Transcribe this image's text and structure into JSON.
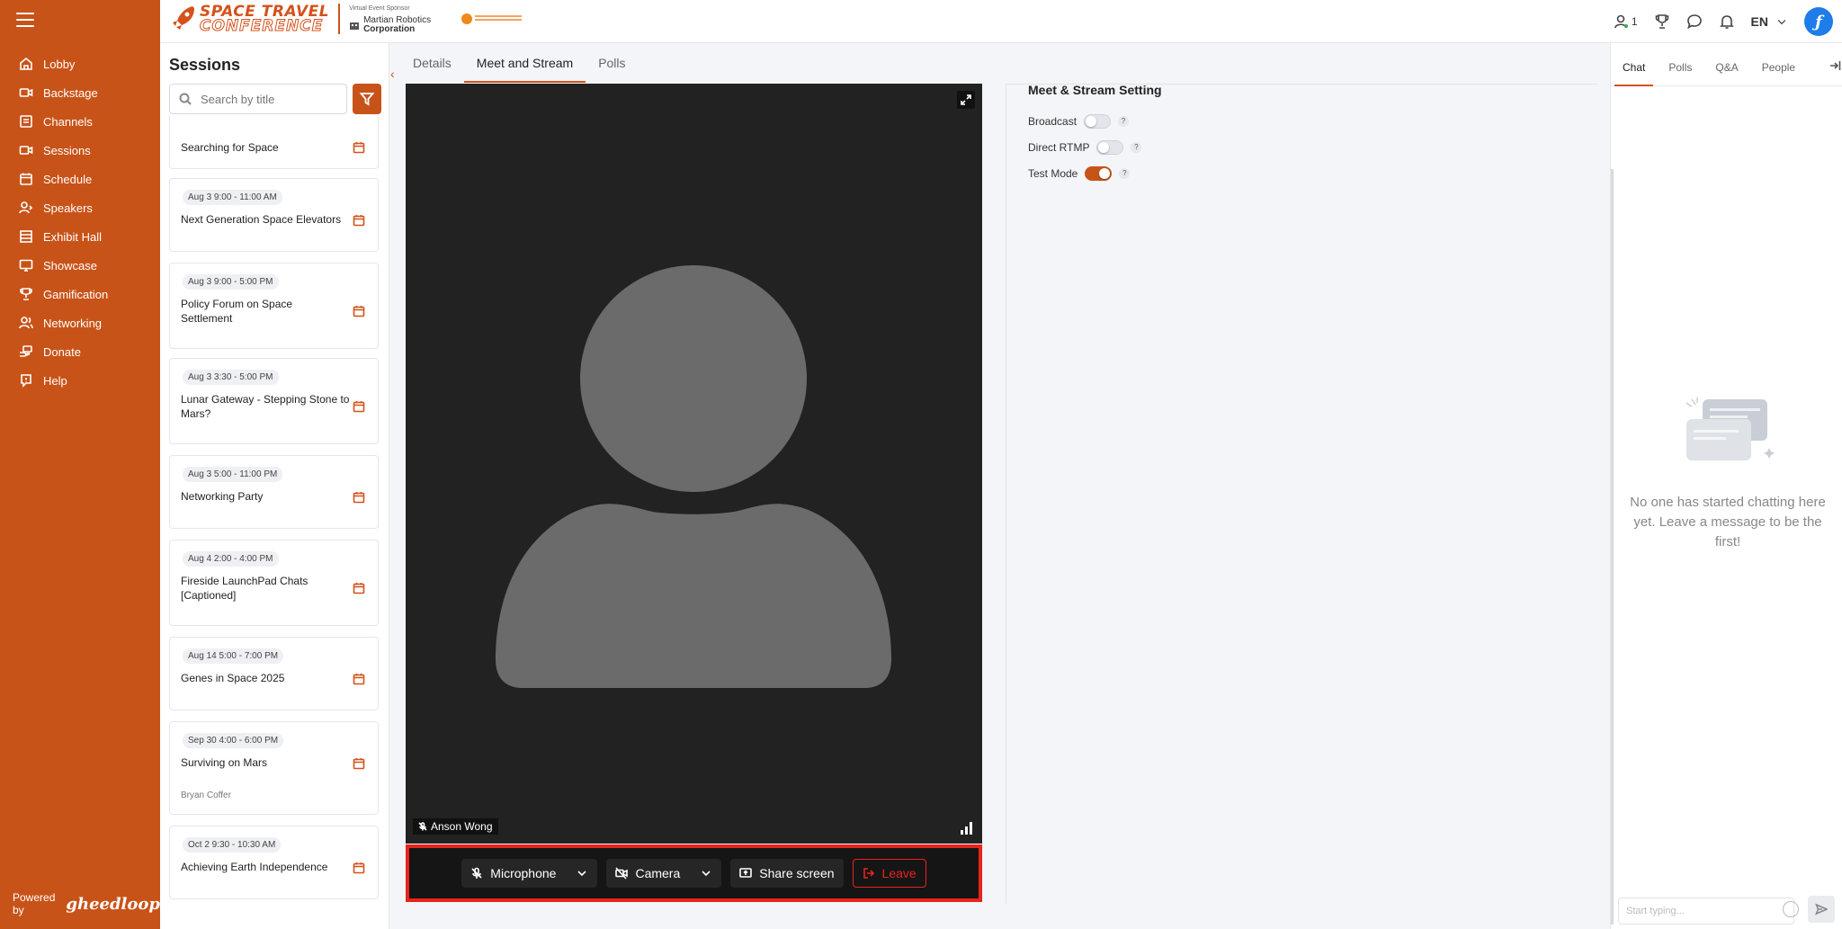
{
  "nav": {
    "items": [
      {
        "label": "Lobby",
        "icon": "home-icon"
      },
      {
        "label": "Backstage",
        "icon": "camera-icon"
      },
      {
        "label": "Channels",
        "icon": "channels-icon"
      },
      {
        "label": "Sessions",
        "icon": "video-icon"
      },
      {
        "label": "Schedule",
        "icon": "calendar-icon"
      },
      {
        "label": "Speakers",
        "icon": "speaker-icon"
      },
      {
        "label": "Exhibit Hall",
        "icon": "building-icon"
      },
      {
        "label": "Showcase",
        "icon": "monitor-icon"
      },
      {
        "label": "Gamification",
        "icon": "trophy-icon"
      },
      {
        "label": "Networking",
        "icon": "people-icon"
      },
      {
        "label": "Donate",
        "icon": "donate-icon"
      },
      {
        "label": "Help",
        "icon": "help-icon"
      }
    ],
    "powered_by": "Powered by",
    "powered_brand": "gheedloop"
  },
  "header": {
    "logo_line1": "SPACE TRAVEL",
    "logo_line2": "CONFERENCE",
    "sponsor_label": "Virtual Event Sponsor",
    "sponsor_name1": "Martian Robotics",
    "sponsor_name2": "Corporation",
    "user_count": "1",
    "language": "EN"
  },
  "sessions": {
    "title": "Sessions",
    "search_placeholder": "Search by title",
    "items": [
      {
        "date": "",
        "title": "Searching for Space",
        "speaker": ""
      },
      {
        "date": "Aug 3 9:00 - 11:00 AM",
        "title": "Next Generation Space Elevators",
        "speaker": ""
      },
      {
        "date": "Aug 3 9:00 - 5:00 PM",
        "title": "Policy Forum on Space Settlement",
        "speaker": ""
      },
      {
        "date": "Aug 3 3:30 - 5:00 PM",
        "title": "Lunar Gateway - Stepping Stone to Mars?",
        "speaker": ""
      },
      {
        "date": "Aug 3 5:00 - 11:00 PM",
        "title": "Networking Party",
        "speaker": ""
      },
      {
        "date": "Aug 4 2:00 - 4:00 PM",
        "title": "Fireside LaunchPad Chats [Captioned]",
        "speaker": ""
      },
      {
        "date": "Aug 14 5:00 - 7:00 PM",
        "title": "Genes in Space 2025",
        "speaker": ""
      },
      {
        "date": "Sep 30 4:00 - 6:00 PM",
        "title": "Surviving on Mars",
        "speaker": "Bryan Coffer"
      },
      {
        "date": "Oct 2 9:30 - 10:30 AM",
        "title": "Achieving Earth Independence",
        "speaker": ""
      }
    ]
  },
  "main_tabs": [
    {
      "label": "Details"
    },
    {
      "label": "Meet and Stream"
    },
    {
      "label": "Polls"
    }
  ],
  "video": {
    "participant_name": "Anson Wong",
    "controls": {
      "microphone": "Microphone",
      "camera": "Camera",
      "share": "Share screen",
      "leave": "Leave"
    }
  },
  "settings": {
    "title": "Meet & Stream Setting",
    "broadcast": "Broadcast",
    "direct_rtmp": "Direct RTMP",
    "test_mode": "Test Mode",
    "help": "?"
  },
  "chat": {
    "tabs": [
      {
        "label": "Chat"
      },
      {
        "label": "Polls"
      },
      {
        "label": "Q&A"
      },
      {
        "label": "People"
      }
    ],
    "empty_message": "No one has started chatting here yet. Leave a message to be the first!",
    "input_placeholder": "Start typing..."
  },
  "colors": {
    "brand": "#c85318",
    "alert": "#e8231c"
  }
}
